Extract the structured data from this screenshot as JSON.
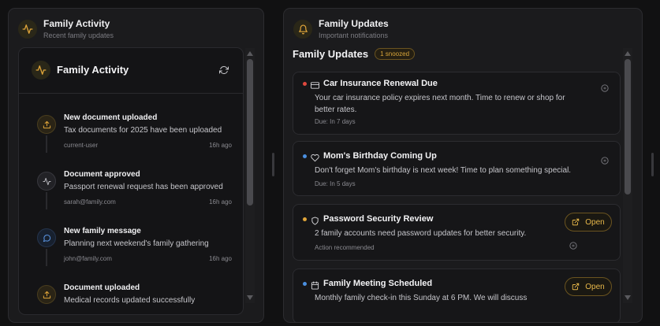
{
  "left_panel": {
    "title": "Family Activity",
    "subtitle": "Recent family updates",
    "card_title": "Family Activity",
    "activities": [
      {
        "title": "New document uploaded",
        "desc": "Tax documents for 2025 have been uploaded",
        "user": "current-user",
        "time": "16h ago",
        "icon": "upload-icon"
      },
      {
        "title": "Document approved",
        "desc": "Passport renewal request has been approved",
        "user": "sarah@family.com",
        "time": "16h ago",
        "icon": "activity-icon"
      },
      {
        "title": "New family message",
        "desc": "Planning next weekend's family gathering",
        "user": "john@family.com",
        "time": "16h ago",
        "icon": "message-icon"
      },
      {
        "title": "Document uploaded",
        "desc": "Medical records updated successfully",
        "user": "",
        "time": "",
        "icon": "upload-icon"
      }
    ]
  },
  "right_panel": {
    "title": "Family Updates",
    "subtitle": "Important notifications",
    "section_title": "Family Updates",
    "snoozed_badge": "1 snoozed",
    "updates": [
      {
        "title": "Car Insurance Renewal Due",
        "desc": "Your car insurance policy expires next month. Time to renew or shop for better rates.",
        "meta": "Due: In 7 days",
        "dot_color": "#e0483e",
        "icon": "credit-card-icon"
      },
      {
        "title": "Mom's Birthday Coming Up",
        "desc": "Don't forget Mom's birthday is next week! Time to plan something special.",
        "meta": "Due: In 5 days",
        "dot_color": "#4a8fe0",
        "icon": "heart-icon"
      },
      {
        "title": "Password Security Review",
        "desc": "2 family accounts need password updates for better security.",
        "meta": "Action recommended",
        "dot_color": "#e0a53a",
        "icon": "shield-icon",
        "action": "Open"
      },
      {
        "title": "Family Meeting Scheduled",
        "desc": "Monthly family check-in this Sunday at 6 PM. We will discuss",
        "meta": "",
        "dot_color": "#4a8fe0",
        "icon": "calendar-icon",
        "action": "Open"
      }
    ]
  },
  "colors": {
    "accent": "#e0a53a",
    "background": "#111112",
    "panel": "#1b1b1d"
  }
}
